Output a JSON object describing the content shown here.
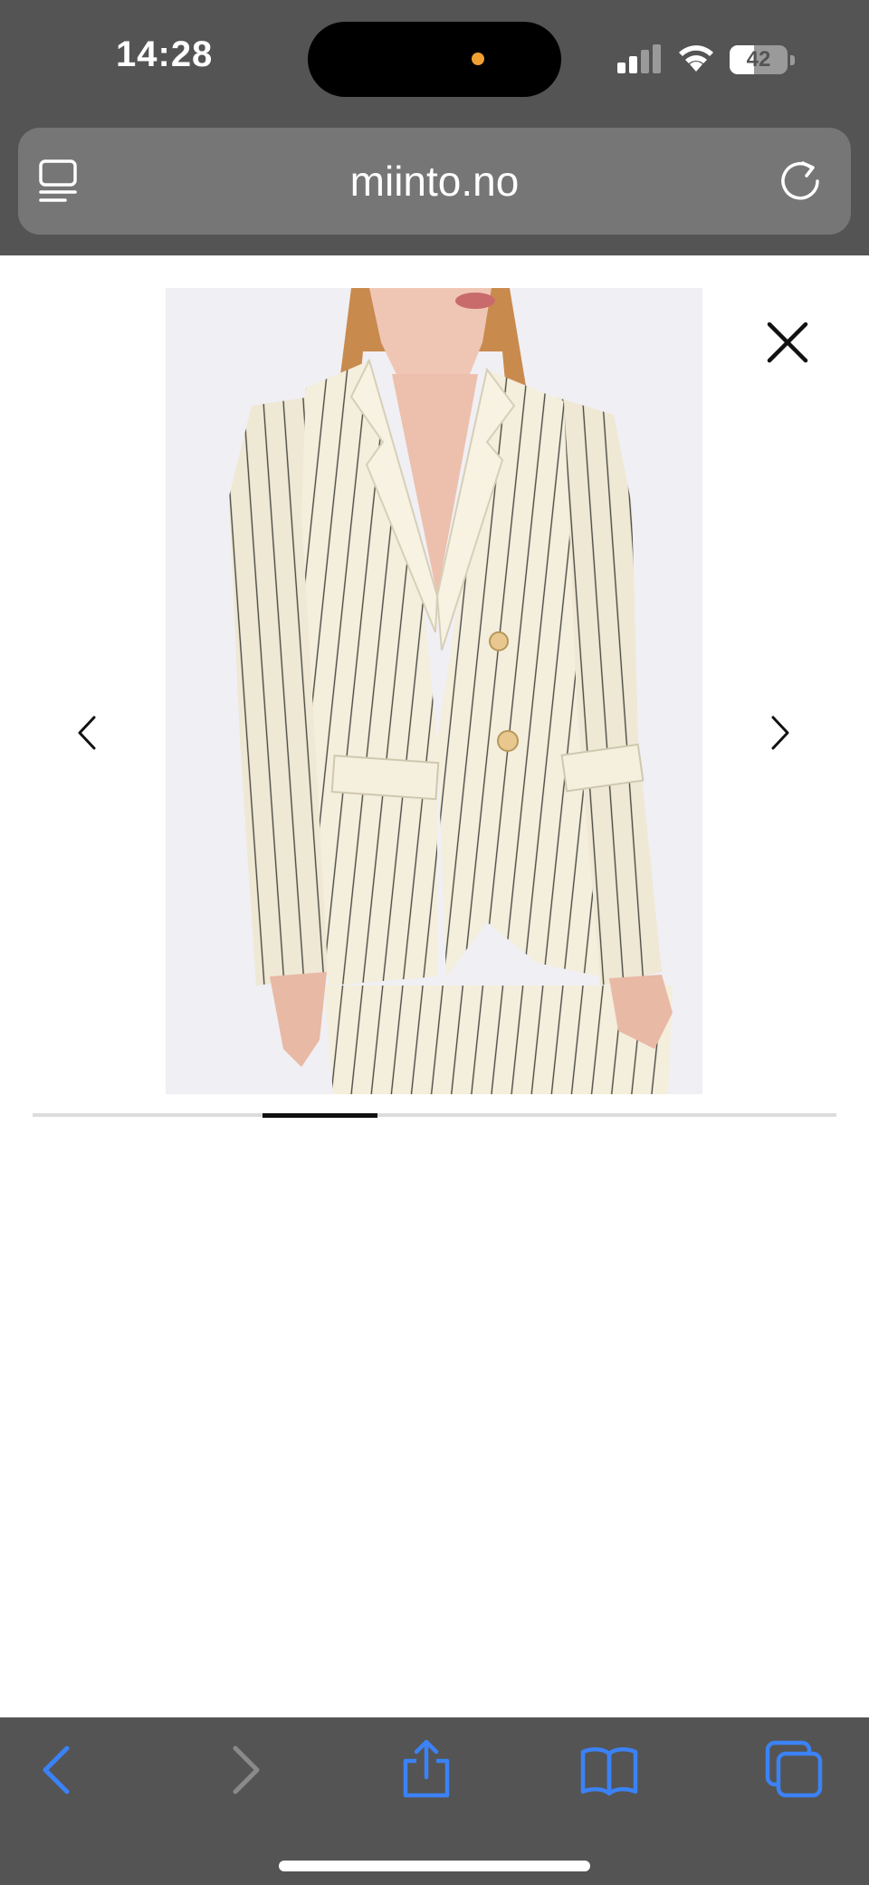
{
  "status_bar": {
    "time": "14:28",
    "battery_level": "42",
    "battery_fraction": 0.42,
    "signal_bars_active": 2,
    "icons": [
      "signal-icon",
      "wifi-icon",
      "battery-icon"
    ],
    "dynamic_island_dot_color": "#f0a030"
  },
  "browser": {
    "url": "miinto.no",
    "icons": [
      "tabs-icon",
      "reload-icon"
    ]
  },
  "gallery": {
    "image_subject": "cream pinstripe blazer",
    "close_icon": "close-icon",
    "prev_icon": "chevron-left-icon",
    "next_icon": "chevron-right-icon",
    "current_image": 3,
    "total_images": 7
  },
  "toolbar": {
    "items": [
      {
        "name": "back",
        "icon": "back-chevron-icon",
        "enabled": true
      },
      {
        "name": "forward",
        "icon": "forward-chevron-icon",
        "enabled": false
      },
      {
        "name": "share",
        "icon": "share-icon",
        "enabled": true
      },
      {
        "name": "bookmarks",
        "icon": "book-icon",
        "enabled": true
      },
      {
        "name": "tabs",
        "icon": "tabs-overview-icon",
        "enabled": true
      }
    ],
    "accent_color": "#3b82f6",
    "disabled_color": "#8a8a8a"
  },
  "colors": {
    "chrome_background": "#545454",
    "url_field": "#767676",
    "page_background": "#ffffff",
    "blazer": "#f4eedc",
    "pinstripe": "#4a4a44"
  }
}
